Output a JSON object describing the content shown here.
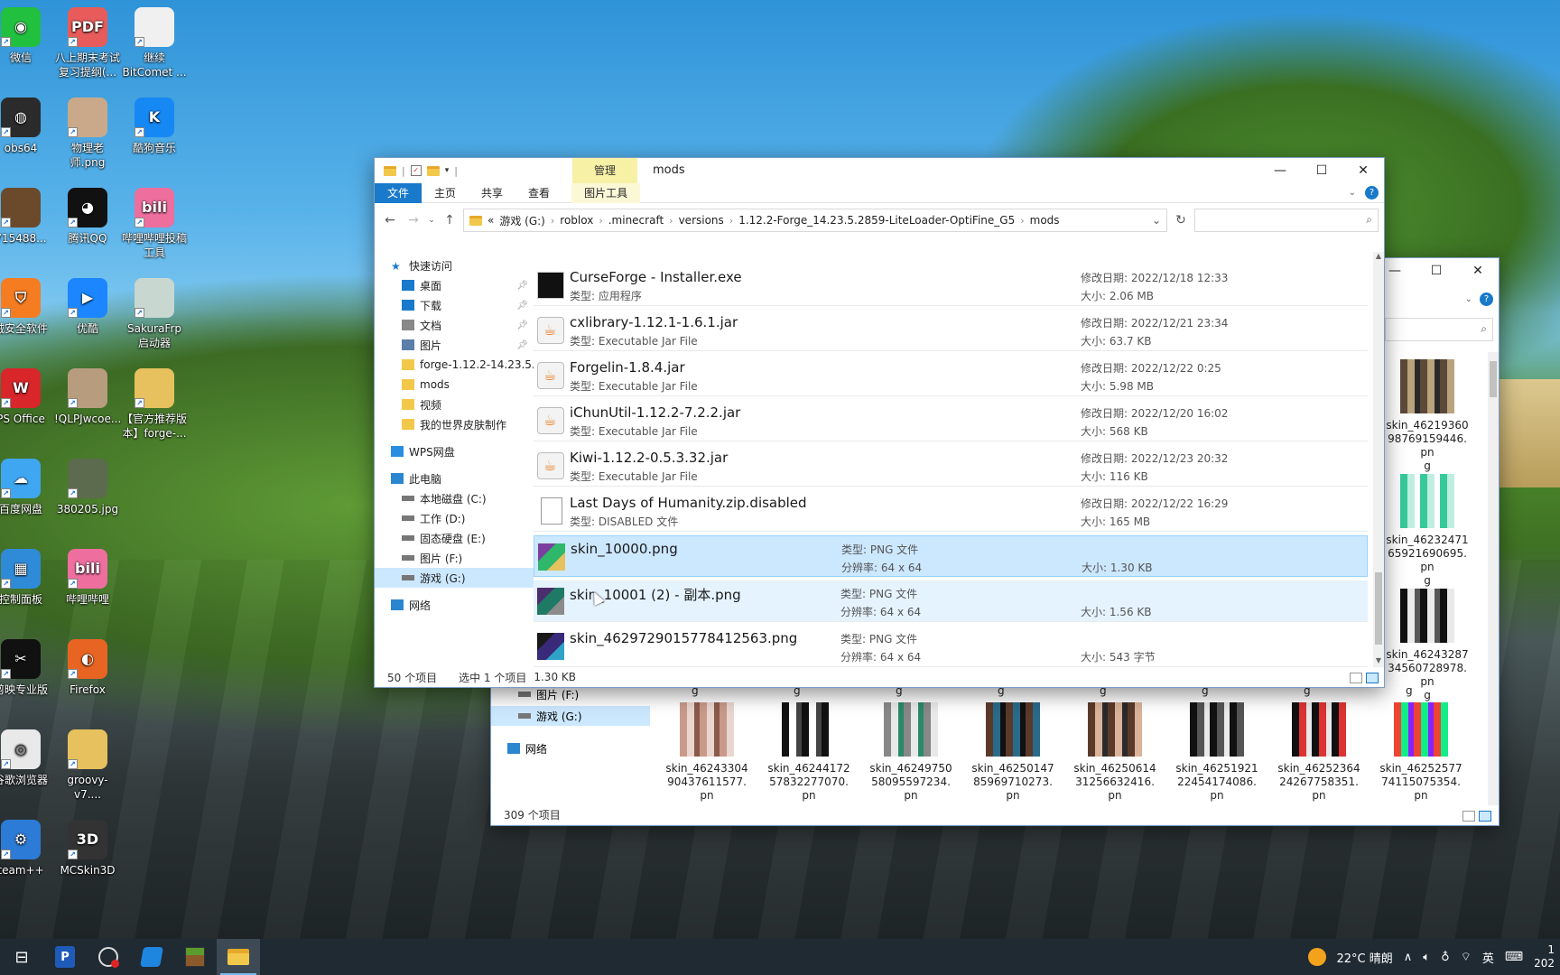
{
  "desktop": {
    "icons": [
      {
        "label": "微信"
      },
      {
        "label": "八上期末考试复习提纲(..."
      },
      {
        "label": "继续 BitComet ..."
      },
      {
        "label": "obs64"
      },
      {
        "label": "物理老师.png"
      },
      {
        "label": "酷狗音乐"
      },
      {
        "label": "715488..."
      },
      {
        "label": "腾讯QQ"
      },
      {
        "label": "哔哩哔哩投稿工具"
      },
      {
        "label": "绒安全软件"
      },
      {
        "label": "优酷"
      },
      {
        "label": "SakuraFrp 启动器"
      },
      {
        "label": "PS Office"
      },
      {
        "label": "!QLPJwcoe..."
      },
      {
        "label": "【官方推荐版本】forge-..."
      },
      {
        "label": "百度网盘"
      },
      {
        "label": "380205.jpg"
      },
      {
        "label": "控制面板"
      },
      {
        "label": "哔哩哔哩"
      },
      {
        "label": "剪映专业版"
      },
      {
        "label": "Firefox"
      },
      {
        "label": "谷歌浏览器"
      },
      {
        "label": "groovy-v7...."
      },
      {
        "label": "team++"
      },
      {
        "label": "MCSkin3D"
      }
    ]
  },
  "explorer_front": {
    "title": "mods",
    "manage_tab": "管理",
    "ribbon_tabs": [
      "文件",
      "主页",
      "共享",
      "查看",
      "图片工具"
    ],
    "address": {
      "prefix": "«",
      "parts": [
        "游戏 (G:)",
        "roblox",
        ".minecraft",
        "versions",
        "1.12.2-Forge_14.23.5.2859-LiteLoader-OptiFine_G5",
        "mods"
      ]
    },
    "nav": [
      {
        "label": "快速访问"
      },
      {
        "label": "桌面"
      },
      {
        "label": "下载"
      },
      {
        "label": "文档"
      },
      {
        "label": "图片"
      },
      {
        "label": "forge-1.12.2-14.23.5.2"
      },
      {
        "label": "mods"
      },
      {
        "label": "视频"
      },
      {
        "label": "我的世界皮肤制作"
      },
      {
        "label": "WPS网盘"
      },
      {
        "label": "此电脑"
      },
      {
        "label": "本地磁盘 (C:)"
      },
      {
        "label": "工作 (D:)"
      },
      {
        "label": "固态硬盘 (E:)"
      },
      {
        "label": "图片 (F:)"
      },
      {
        "label": "游戏 (G:)"
      },
      {
        "label": "网络"
      }
    ],
    "files": [
      {
        "name": "CurseForge - Installer.exe",
        "type": "类型: 应用程序",
        "date": "修改日期: 2022/12/18 12:33",
        "size": "大小: 2.06 MB"
      },
      {
        "name": "cxlibrary-1.12.1-1.6.1.jar",
        "type": "类型: Executable Jar File",
        "date": "修改日期: 2022/12/21 23:34",
        "size": "大小: 63.7 KB"
      },
      {
        "name": "Forgelin-1.8.4.jar",
        "type": "类型: Executable Jar File",
        "date": "修改日期: 2022/12/22 0:25",
        "size": "大小: 5.98 MB"
      },
      {
        "name": "iChunUtil-1.12.2-7.2.2.jar",
        "type": "类型: Executable Jar File",
        "date": "修改日期: 2022/12/20 16:02",
        "size": "大小: 568 KB"
      },
      {
        "name": "Kiwi-1.12.2-0.5.3.32.jar",
        "type": "类型: Executable Jar File",
        "date": "修改日期: 2022/12/23 20:32",
        "size": "大小: 116 KB"
      },
      {
        "name": "Last Days of Humanity.zip.disabled",
        "type": "类型: DISABLED 文件",
        "date": "修改日期: 2022/12/22 16:29",
        "size": "大小: 165 MB"
      },
      {
        "name": "skin_10000.png",
        "type": "",
        "ptype": "类型: PNG 文件",
        "res": "分辨率: 64 x 64",
        "size": "大小: 1.30 KB"
      },
      {
        "name": "skin_10001 (2) - 副本.png",
        "type": "",
        "ptype": "类型: PNG 文件",
        "res": "分辨率: 64 x 64",
        "size": "大小: 1.56 KB"
      },
      {
        "name": "skin_4629729015778412563.png",
        "type": "",
        "ptype": "类型: PNG 文件",
        "res": "分辨率: 64 x 64",
        "size": "大小: 543 字节"
      }
    ],
    "status": {
      "count": "50 个项目",
      "selected": "选中 1 个项目",
      "size": "1.30 KB"
    }
  },
  "explorer_back": {
    "nav": [
      {
        "label": "图片 (F:)"
      },
      {
        "label": "游戏 (G:)"
      },
      {
        "label": "网络"
      }
    ],
    "right_column": [
      {
        "label": "skin_4621936098769159446.pn"
      },
      {
        "label": "skin_4623247165921690695.pn"
      },
      {
        "label": "skin_4624328734560728978.pn"
      }
    ],
    "bottom_row": [
      {
        "label": "skin_4624330490437611577.pn"
      },
      {
        "label": "skin_4624417257832277070.pn"
      },
      {
        "label": "skin_4624975058095597234.pn"
      },
      {
        "label": "skin_4625014785969710273.pn"
      },
      {
        "label": "skin_4625061431256632416.pn"
      },
      {
        "label": "skin_4625192122454174086.pn"
      },
      {
        "label": "skin_4625236424267758351.pn"
      },
      {
        "label": "skin_4625257774115075354.pn"
      }
    ],
    "wrap_char": "g",
    "status": {
      "count": "309 个项目"
    }
  },
  "taskbar": {
    "weather": "22°C 晴朗",
    "ime": "英",
    "clock_partial": "1",
    "date_partial": "202"
  }
}
